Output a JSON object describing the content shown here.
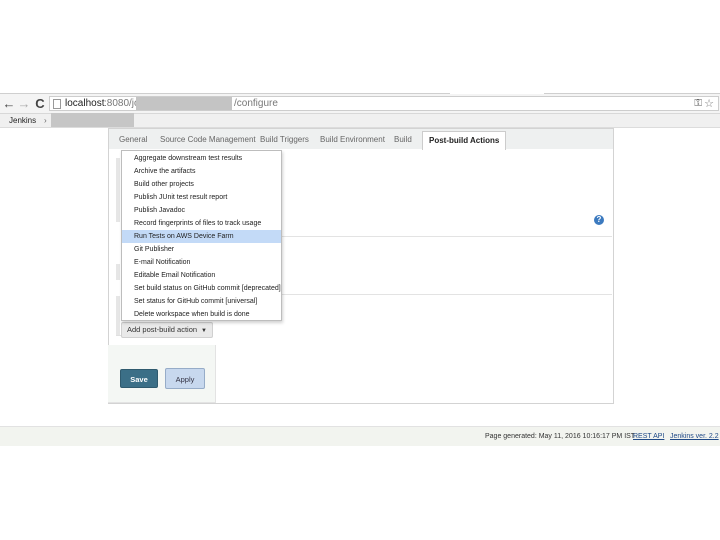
{
  "browser": {
    "url_host": "localhost",
    "url_port_path": ":8080/job/",
    "url_suffix": "/configure",
    "back_icon": "←",
    "forward_icon": "→",
    "reload_icon": "C",
    "key_icon": "⚿",
    "star_icon": "☆"
  },
  "breadcrumb": {
    "root": "Jenkins",
    "separator": "›"
  },
  "tabs": [
    {
      "label": "General"
    },
    {
      "label": "Source Code Management"
    },
    {
      "label": "Build Triggers"
    },
    {
      "label": "Build Environment"
    },
    {
      "label": "Build"
    },
    {
      "label": "Post-build Actions",
      "active": true
    }
  ],
  "help_icon": "?",
  "add_action": {
    "label": "Add post-build action",
    "caret": "▼"
  },
  "menu": {
    "items": [
      {
        "label": "Aggregate downstream test results"
      },
      {
        "label": "Archive the artifacts"
      },
      {
        "label": "Build other projects"
      },
      {
        "label": "Publish JUnit test result report"
      },
      {
        "label": "Publish Javadoc"
      },
      {
        "label": "Record fingerprints of files to track usage"
      },
      {
        "label": "Run Tests on AWS Device Farm",
        "selected": true
      },
      {
        "label": "Git Publisher"
      },
      {
        "label": "E-mail Notification"
      },
      {
        "label": "Editable Email Notification"
      },
      {
        "label": "Set build status on GitHub commit [deprecated]"
      },
      {
        "label": "Set status for GitHub commit [universal]"
      },
      {
        "label": "Delete workspace when build is done"
      }
    ]
  },
  "buttons": {
    "save": "Save",
    "apply": "Apply"
  },
  "footer": {
    "generated": "Page generated: May 11, 2016 10:16:17 PM IST",
    "rest_api": "REST API",
    "version": "Jenkins ver. 2.2"
  },
  "colors": {
    "save_button": "#3b6f87",
    "apply_button": "#c7d8ee",
    "menu_highlight": "#c3daf7",
    "link": "#204a87"
  }
}
